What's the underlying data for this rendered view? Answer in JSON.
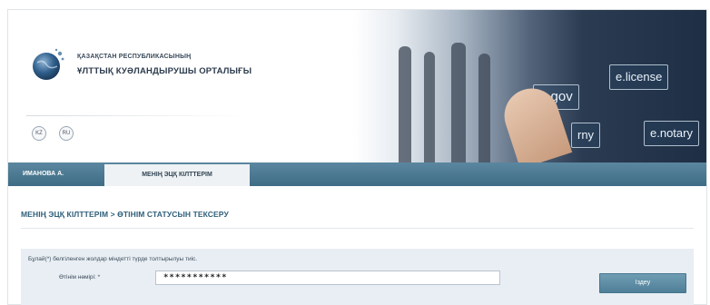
{
  "header": {
    "org_line1": "ҚАЗАҚСТАН РЕСПУБЛИКАСЫНЫҢ",
    "org_line2": "ҰЛТТЫҚ КУӘЛАНДЫРУШЫ ОРТАЛЫҒЫ",
    "lang": {
      "kz": "KZ",
      "ru": "RU"
    },
    "banner_tiles": [
      "e.license",
      "e.gov",
      "e.notary",
      "rny"
    ]
  },
  "nav": {
    "user_label": "ИМАНОВА А.",
    "tab_label": "МЕНІҢ ЭЦҚ КІЛТТЕРІМ"
  },
  "breadcrumb": "МЕНІҢ ЭЦҚ КІЛТТЕРІМ > ӨТІНІМ СТАТУСЫН ТЕКСЕРУ",
  "form": {
    "required_note": "Бұлай(*) белгіленген жолдар міндетті түрде толтырылуы тиіс.",
    "field_label": "Өтінім нөмірі: *",
    "field_value": "***********",
    "search_button": "Іздеу"
  },
  "colors": {
    "nav_bg": "#4a7690",
    "accent_text": "#2f5f7a",
    "panel_bg": "#e8eef3",
    "button_bg": "#5f8ea6"
  }
}
